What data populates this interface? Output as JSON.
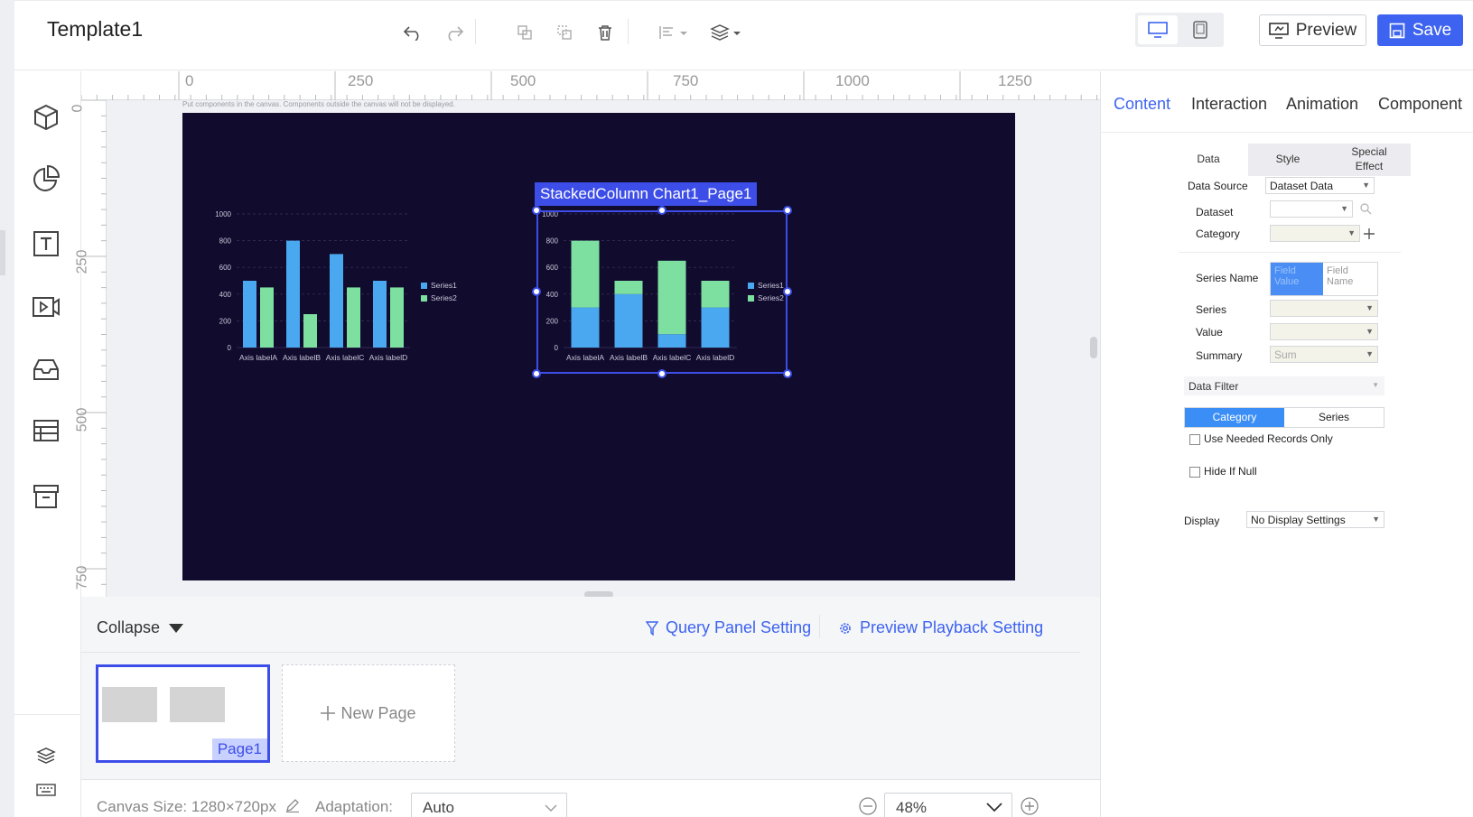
{
  "header": {
    "title": "Template1",
    "preview_label": "Preview",
    "save_label": "Save"
  },
  "ruler": {
    "h_ticks": [
      "0",
      "250",
      "500",
      "750",
      "1000",
      "1250"
    ],
    "v_ticks": [
      "0",
      "250",
      "500",
      "750"
    ]
  },
  "canvas": {
    "hint": "Put components in the canvas. Components outside the canvas will not be displayed.",
    "selected_component": "StackedColumn Chart1_Page1"
  },
  "colors": {
    "accent": "#3d63f0",
    "selection": "#3d4ee8",
    "canvas_bg": "#110b2e",
    "series1": "#4aa8f0",
    "series2": "#7ee0a0"
  },
  "chart_data": [
    {
      "type": "bar",
      "categories": [
        "Axis labelA",
        "Axis labelB",
        "Axis labelC",
        "Axis labelD"
      ],
      "series": [
        {
          "name": "Series1",
          "values": [
            500,
            800,
            700,
            500
          ]
        },
        {
          "name": "Series2",
          "values": [
            450,
            250,
            450,
            450
          ]
        }
      ],
      "yticks": [
        "0",
        "200",
        "400",
        "600",
        "800",
        "1000"
      ],
      "ylim": [
        0,
        1000
      ],
      "legend": "right",
      "grid": true
    },
    {
      "type": "bar",
      "stacked": true,
      "categories": [
        "Axis labelA",
        "Axis labelB",
        "Axis labelC",
        "Axis labelD"
      ],
      "series": [
        {
          "name": "Series1",
          "values": [
            300,
            400,
            100,
            300
          ]
        },
        {
          "name": "Series2",
          "values": [
            500,
            100,
            550,
            200
          ]
        }
      ],
      "yticks": [
        "0",
        "200",
        "400",
        "600",
        "800",
        "1000"
      ],
      "ylim": [
        0,
        1000
      ],
      "legend": "right",
      "grid": true
    }
  ],
  "bottom": {
    "collapse_label": "Collapse",
    "query_panel": "Query Panel Setting",
    "preview_playback": "Preview Playback Setting",
    "page1_label": "Page1",
    "new_page_label": "New Page",
    "canvas_size": "Canvas Size: 1280×720px",
    "adaptation_label": "Adaptation:",
    "adaptation_value": "Auto",
    "zoom_value": "48%"
  },
  "right_panel": {
    "tabs": [
      "Content",
      "Interaction",
      "Animation",
      "Component"
    ],
    "sub_tabs": [
      "Data",
      "Style",
      "Special Effect"
    ],
    "data_source_label": "Data Source",
    "data_source_value": "Dataset Data",
    "dataset_label": "Dataset",
    "category_label": "Category",
    "series_name_label": "Series Name",
    "series_name_options": [
      "Field Value",
      "Field Name"
    ],
    "series_label": "Series",
    "value_label": "Value",
    "summary_label": "Summary",
    "summary_value": "Sum",
    "data_filter_label": "Data Filter",
    "filter_tabs": [
      "Category",
      "Series"
    ],
    "use_needed_label": "Use Needed Records Only",
    "hide_if_null_label": "Hide If Null",
    "display_label": "Display",
    "display_value": "No Display Settings"
  }
}
